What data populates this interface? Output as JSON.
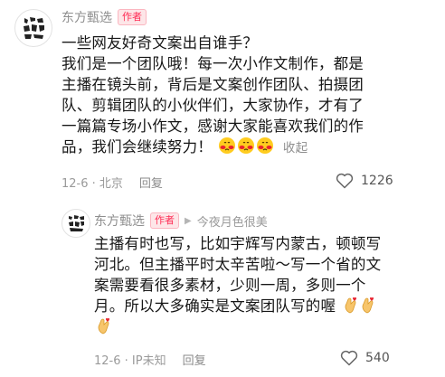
{
  "comment1": {
    "username": "东方甄选",
    "badge": "作者",
    "avatar_text": "东方甄选",
    "lines": [
      "一些网友好奇文案出自谁手？",
      "我们是一个团队哦！每一次小作文制作，都是",
      "主播在镜头前，背后是文案创作团队、拍摄团",
      "队、剪辑团队的小伙伴们，大家协作，才有了",
      "一篇篇专场小作文，感谢大家能喜欢我们的作",
      "品，我们会继续努力！"
    ],
    "emojis": [
      "shy-blush-emoji",
      "shy-blush-emoji",
      "shy-blush-emoji"
    ],
    "collapse_label": "收起",
    "date_location": "12-6 · 北京",
    "reply_label": "回复",
    "like_count": "1226"
  },
  "comment2": {
    "username": "东方甄选",
    "badge": "作者",
    "reply_to": "今夜月色很美",
    "avatar_text": "东方甄选",
    "lines": [
      "主播有时也写，比如宇辉写内蒙古，顿顿写",
      "河北。但主播平时太辛苦啦～写一个省的文",
      "案需要看很多素材，少则一周，多则一个",
      "月。所以大多确实是文案团队写的喔"
    ],
    "emojis": [
      "finger-heart-emoji",
      "finger-heart-emoji",
      "finger-heart-emoji"
    ],
    "date_location": "12-6 · IP未知",
    "reply_label": "回复",
    "like_count": "540"
  },
  "colors": {
    "badge_red": "#fe2c55",
    "meta_gray": "#9a9a9a",
    "emoji_yellow": "#ffcc1f",
    "emoji_red": "#e8232f"
  }
}
